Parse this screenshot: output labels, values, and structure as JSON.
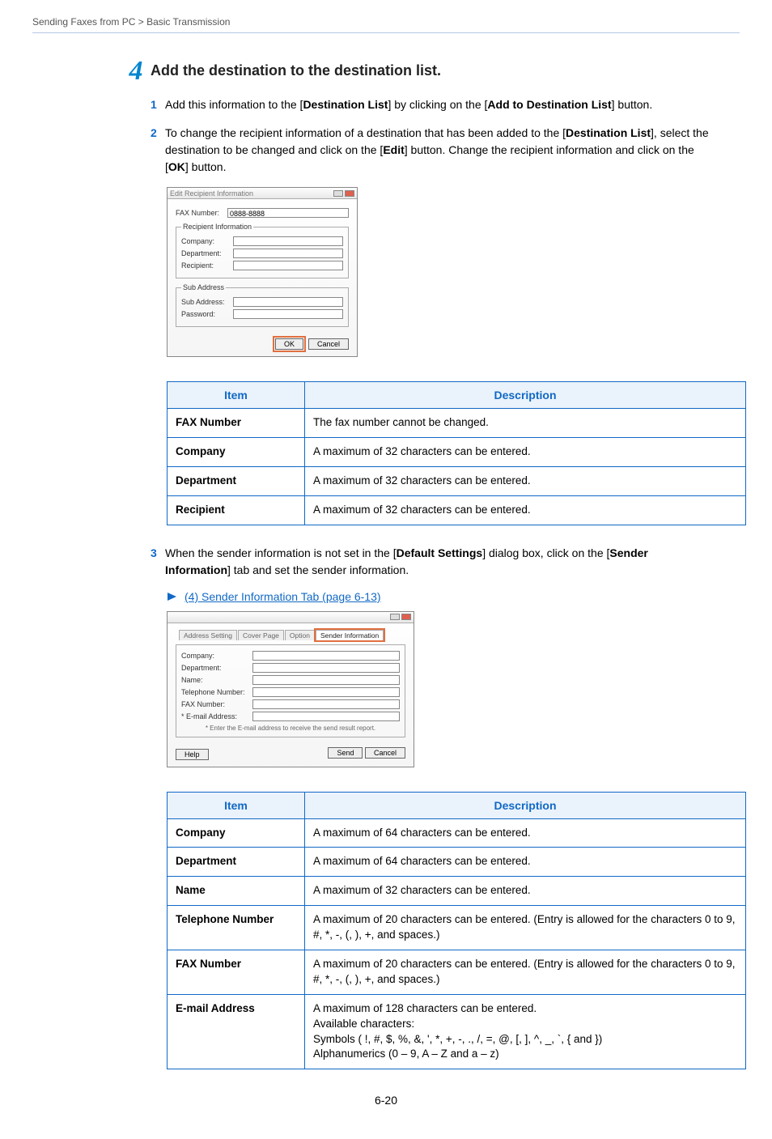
{
  "breadcrumb": "Sending Faxes from PC > Basic Transmission",
  "step_number": "4",
  "step_heading": "Add the destination to the destination list.",
  "substeps": {
    "s1_num": "1",
    "s1_a": "Add this information to the [",
    "s1_b": "Destination List",
    "s1_c": "] by clicking on the [",
    "s1_d": "Add to Destination List",
    "s1_e": "] button.",
    "s2_num": "2",
    "s2_a": "To change the recipient information of a destination that has been added to the [",
    "s2_b": "Destination List",
    "s2_c": "], select the destination to be changed and click on the [",
    "s2_d": "Edit",
    "s2_e": "] button. Change the recipient information and click on the [",
    "s2_f": "OK",
    "s2_g": "] button.",
    "s3_num": "3",
    "s3_a": "When the sender information is not set in the [",
    "s3_b": "Default Settings",
    "s3_c": "] dialog box, click on the [",
    "s3_d": "Sender Information",
    "s3_e": "] tab and set the sender information."
  },
  "link_text": "(4) Sender Information Tab (page 6-13)",
  "dialog1": {
    "title": "Edit Recipient Information",
    "faxnum_lbl": "FAX Number:",
    "faxnum_val": "0888-8888",
    "grp1": "Recipient Information",
    "company": "Company:",
    "department": "Department:",
    "recipient": "Recipient:",
    "grp2": "Sub Address",
    "subaddr": "Sub Address:",
    "password": "Password:",
    "ok": "OK",
    "cancel": "Cancel"
  },
  "dialog2": {
    "tab1": "Address Setting",
    "tab2": "Cover Page",
    "tab3": "Option",
    "tab4": "Sender Information",
    "company": "Company:",
    "department": "Department:",
    "name": "Name:",
    "tel": "Telephone Number:",
    "fax": "FAX Number:",
    "email": "* E-mail Address:",
    "note": "* Enter the E-mail address to receive the send result report.",
    "help": "Help",
    "send": "Send",
    "cancel": "Cancel"
  },
  "table1": {
    "hdr_item": "Item",
    "hdr_desc": "Description",
    "rows": [
      {
        "item": "FAX Number",
        "desc": "The fax number cannot be changed."
      },
      {
        "item": "Company",
        "desc": "A maximum of 32 characters can be entered."
      },
      {
        "item": "Department",
        "desc": "A maximum of 32 characters can be entered."
      },
      {
        "item": "Recipient",
        "desc": "A maximum of 32 characters can be entered."
      }
    ]
  },
  "table2": {
    "hdr_item": "Item",
    "hdr_desc": "Description",
    "rows": [
      {
        "item": "Company",
        "desc": "A maximum of 64 characters can be entered."
      },
      {
        "item": "Department",
        "desc": "A maximum of 64 characters can be entered."
      },
      {
        "item": "Name",
        "desc": "A maximum of 32 characters can be entered."
      },
      {
        "item": "Telephone Number",
        "desc": "A maximum of 20 characters can be entered. (Entry is allowed for the characters 0 to 9, #, *, -, (, ), +, and spaces.)"
      },
      {
        "item": "FAX Number",
        "desc": "A maximum of 20 characters can be entered. (Entry is allowed for the characters 0 to 9, #, *, -, (, ), +, and spaces.)"
      },
      {
        "item": "E-mail Address",
        "desc": "A maximum of 128 characters can be entered.\nAvailable characters:\nSymbols ( !, #, $, %, &, ', *, +, -, ., /, =, @, [, ], ^, _, `, { and })\nAlphanumerics (0 – 9, A – Z and a – z)"
      }
    ]
  },
  "page_number": "6-20"
}
